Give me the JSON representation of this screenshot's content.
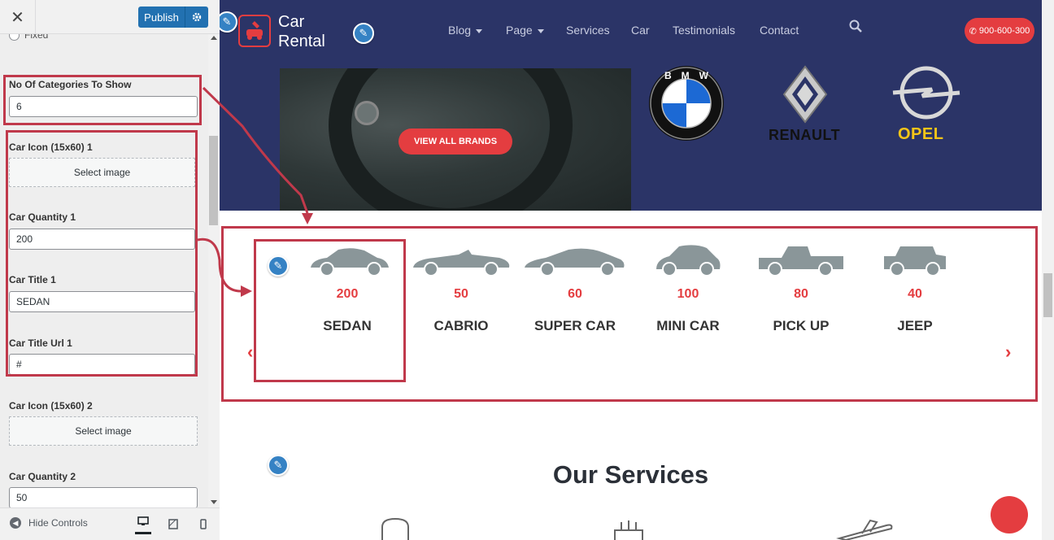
{
  "customizer": {
    "publish_label": "Publish",
    "radio_option": "Fixed",
    "controls": {
      "num_categories_label": "No Of Categories To Show",
      "num_categories_value": "6",
      "car_icon_1_label": "Car Icon (15x60) 1",
      "select_image_label": "Select image",
      "car_qty_1_label": "Car Quantity 1",
      "car_qty_1_value": "200",
      "car_title_1_label": "Car Title 1",
      "car_title_1_value": "SEDAN",
      "car_title_url_1_label": "Car Title Url 1",
      "car_title_url_1_value": "#",
      "car_icon_2_label": "Car Icon (15x60) 2",
      "car_qty_2_label": "Car Quantity 2",
      "car_qty_2_value": "50"
    },
    "hide_controls_label": "Hide Controls"
  },
  "site": {
    "logo_line1": "Car",
    "logo_line2": "Rental",
    "menu": [
      {
        "label": "Blog",
        "dropdown": true
      },
      {
        "label": "Page",
        "dropdown": true
      },
      {
        "label": "Services",
        "dropdown": false
      },
      {
        "label": "Car",
        "dropdown": false
      },
      {
        "label": "Testimonials",
        "dropdown": false
      },
      {
        "label": "Contact",
        "dropdown": false
      }
    ],
    "phone": "900-600-300",
    "view_all_brands": "VIEW ALL BRANDS",
    "brands": [
      {
        "name": "BMW"
      },
      {
        "name": "RENAULT"
      },
      {
        "name": "OPEL"
      }
    ],
    "categories": [
      {
        "qty": "200",
        "title": "SEDAN",
        "icon": "sedan-icon"
      },
      {
        "qty": "50",
        "title": "CABRIO",
        "icon": "cabrio-icon"
      },
      {
        "qty": "60",
        "title": "SUPER CAR",
        "icon": "supercar-icon"
      },
      {
        "qty": "100",
        "title": "MINI CAR",
        "icon": "minicar-icon"
      },
      {
        "qty": "80",
        "title": "PICK UP",
        "icon": "pickup-icon"
      },
      {
        "qty": "40",
        "title": "JEEP",
        "icon": "jeep-icon"
      }
    ],
    "services_title": "Our Services"
  },
  "colors": {
    "nav_bg": "#2b3467",
    "accent": "#e43d40",
    "annotation": "#c0394b",
    "wp_blue": "#2271b1"
  }
}
